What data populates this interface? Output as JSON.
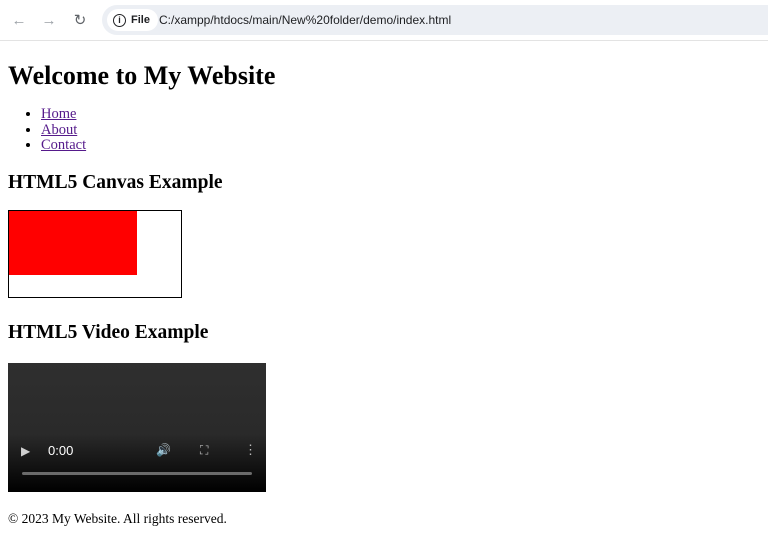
{
  "browser": {
    "chip_label": "File",
    "url": "C:/xampp/htdocs/main/New%20folder/demo/index.html",
    "icons": {
      "back": "back-arrow-icon",
      "forward": "forward-arrow-icon",
      "reload": "reload-icon",
      "info": "info-icon"
    }
  },
  "page": {
    "heading": "Welcome to My Website",
    "nav": [
      "Home",
      "About",
      "Contact"
    ],
    "canvas_heading": "HTML5 Canvas Example",
    "canvas_fill": "#ff0000",
    "video_heading": "HTML5 Video Example",
    "video": {
      "time": "0:00",
      "progress": 0
    },
    "footer": "© 2023 My Website. All rights reserved."
  }
}
